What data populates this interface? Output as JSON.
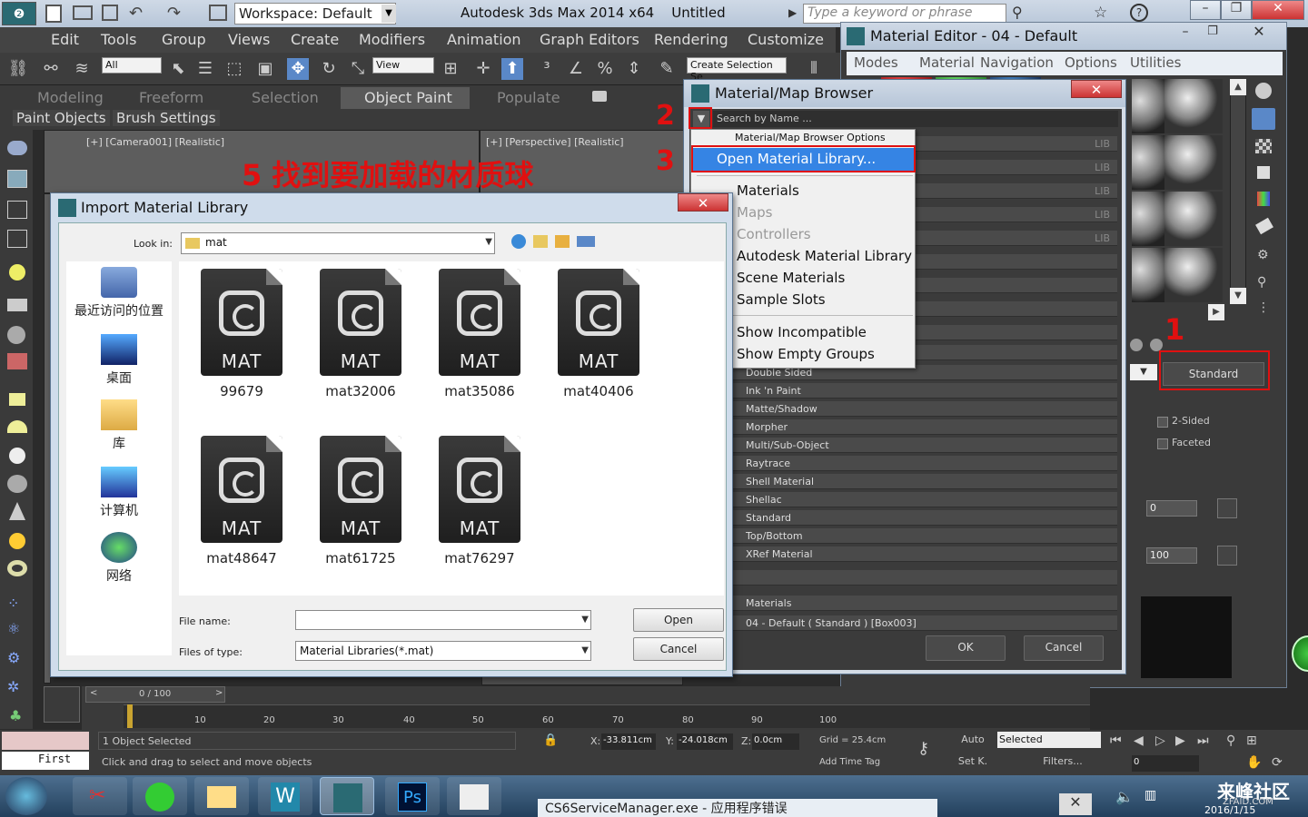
{
  "titlebar": {
    "workspace": "Workspace: Default",
    "app_title": "Autodesk 3ds Max  2014 x64",
    "doc_title": "Untitled",
    "search_placeholder": "Type a keyword or phrase"
  },
  "menubar": [
    "Edit",
    "Tools",
    "Group",
    "Views",
    "Create",
    "Modifiers",
    "Animation",
    "Graph Editors",
    "Rendering",
    "Customize"
  ],
  "toolbar": {
    "filter": "All",
    "refcoord": "View",
    "selset": "Create Selection Se"
  },
  "ribbon": {
    "tabs": [
      "Modeling",
      "Freeform",
      "Selection",
      "Object Paint",
      "Populate"
    ],
    "active_tab": "Object Paint",
    "subtabs": [
      "Paint Objects",
      "Brush Settings"
    ]
  },
  "viewports": {
    "left_label": "[+] [Camera001] [Realistic]",
    "right_label": "[+] [Perspective] [Realistic]"
  },
  "annotations": {
    "step5": "5  找到要加载的材质球",
    "step2": "2",
    "step3": "3",
    "step1": "1"
  },
  "import_dialog": {
    "title": "Import Material Library",
    "look_in_label": "Look in:",
    "look_in_value": "mat",
    "places": [
      "最近访问的位置",
      "桌面",
      "库",
      "计算机",
      "网络"
    ],
    "files": [
      "99679",
      "mat32006",
      "mat35086",
      "mat40406",
      "mat48647",
      "mat61725",
      "mat76297"
    ],
    "file_ext": "MAT",
    "file_name_label": "File name:",
    "file_name_value": "",
    "file_type_label": "Files of type:",
    "file_type_value": "Material Libraries(*.mat)",
    "open": "Open",
    "cancel": "Cancel"
  },
  "material_editor": {
    "title": "Material Editor - 04 - Default",
    "menus": [
      "Modes",
      "Material",
      "Navigation",
      "Options",
      "Utilities"
    ],
    "standard": "Standard",
    "two_sided": "2-Sided",
    "faceted": "Faceted",
    "spin1": "0",
    "spin2": "100"
  },
  "browser": {
    "title": "Material/Map Browser",
    "search": "Search by Name ...",
    "lib": "LIB",
    "list": [
      "Double Sided",
      "Ink 'n Paint",
      "Matte/Shadow",
      "Morpher",
      "Multi/Sub-Object",
      "Raytrace",
      "Shell Material",
      "Shellac",
      "Standard",
      "Top/Bottom",
      "XRef Material"
    ],
    "section_materials": "Materials",
    "scene_entry": "04 - Default ( Standard ) [Box003]",
    "ok": "OK",
    "cancel": "Cancel"
  },
  "dropdown": {
    "header": "Material/Map Browser Options",
    "open_lib": "Open Material Library...",
    "items": [
      "Materials",
      "Maps",
      "Controllers",
      "Autodesk Material Library",
      "Scene Materials",
      "Sample Slots",
      "Show Incompatible",
      "Show Empty Groups"
    ]
  },
  "timeline": {
    "frame": "0 / 100",
    "ticks": [
      "0",
      "10",
      "20",
      "30",
      "40",
      "50",
      "60",
      "70",
      "80",
      "90",
      "100"
    ]
  },
  "status": {
    "selected": "1 Object Selected",
    "hint": "Click and drag to select and move objects",
    "x": "-33.811cm",
    "y": "-24.018cm",
    "z": "0.0cm",
    "grid": "Grid = 25.4cm",
    "addtag": "Add Time Tag",
    "auto": "Auto",
    "setk": "Set K.",
    "selected_dd": "Selected",
    "filters": "Filters...",
    "first": "First",
    "frame_field": "0"
  },
  "taskbar": {
    "notice": "CS6ServiceManager.exe - 应用程序错误",
    "watermark": "来峰社区",
    "watermark2": "ZFAID.COM",
    "date": "2016/1/15"
  }
}
